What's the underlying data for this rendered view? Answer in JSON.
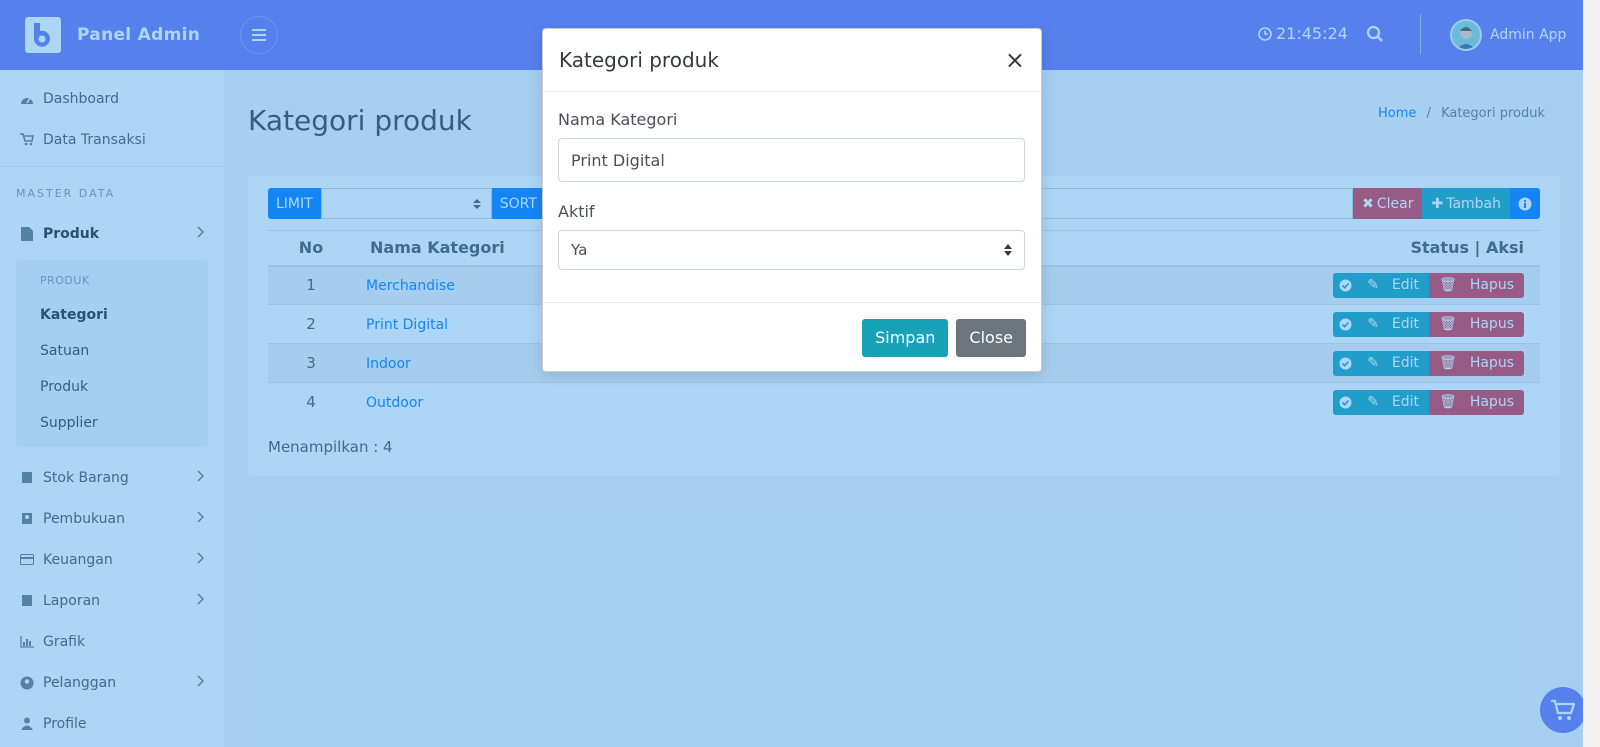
{
  "brand": {
    "name": "Panel Admin"
  },
  "topbar": {
    "clock": "21:45:24",
    "user_name": "Admin App"
  },
  "sidebar": {
    "top_items": [
      {
        "label": "Dashboard",
        "icon": "dashboard-icon"
      },
      {
        "label": "Data Transaksi",
        "icon": "cart-icon"
      }
    ],
    "section_header": "MASTER DATA",
    "produk": {
      "label": "Produk",
      "icon": "file-icon"
    },
    "submenu": {
      "header": "PRODUK",
      "items": [
        "Kategori",
        "Satuan",
        "Produk",
        "Supplier"
      ]
    },
    "bottom_items": [
      {
        "label": "Stok Barang",
        "icon": "book-icon",
        "has_children": true
      },
      {
        "label": "Pembukuan",
        "icon": "contact-book-icon",
        "has_children": true
      },
      {
        "label": "Keuangan",
        "icon": "credit-card-icon",
        "has_children": true
      },
      {
        "label": "Laporan",
        "icon": "book-icon",
        "has_children": true
      },
      {
        "label": "Grafik",
        "icon": "bar-chart-icon",
        "has_children": false
      },
      {
        "label": "Pelanggan",
        "icon": "user-circle-icon",
        "has_children": true
      },
      {
        "label": "Profile",
        "icon": "user-icon",
        "has_children": false
      }
    ]
  },
  "page": {
    "title": "Kategori produk",
    "breadcrumb": {
      "home": "Home",
      "separator": "/",
      "current": "Kategori produk"
    }
  },
  "toolbar": {
    "limit_label": "LIMIT",
    "sort_label": "SORT",
    "clear_label": "Clear",
    "tambah_label": "Tambah"
  },
  "table": {
    "headers": {
      "no": "No",
      "name": "Nama Kategori",
      "action": "Status | Aksi"
    },
    "rows": [
      {
        "no": "1",
        "name": "Merchandise"
      },
      {
        "no": "2",
        "name": "Print Digital"
      },
      {
        "no": "3",
        "name": "Indoor"
      },
      {
        "no": "4",
        "name": "Outdoor"
      }
    ],
    "edit_label": "Edit",
    "delete_label": "Hapus",
    "footer": "Menampilkan : 4"
  },
  "modal": {
    "title": "Kategori produk",
    "close_symbol": "×",
    "field_name_label": "Nama Kategori",
    "field_name_value": "Print Digital",
    "field_active_label": "Aktif",
    "field_active_value": "Ya",
    "save_label": "Simpan",
    "close_label": "Close"
  },
  "colors": {
    "primary": "#6f74f0",
    "info": "#17a2b8",
    "danger": "#dc3545",
    "blue": "#007bff",
    "overlay": "rgba(50,150,230,0.4)"
  }
}
